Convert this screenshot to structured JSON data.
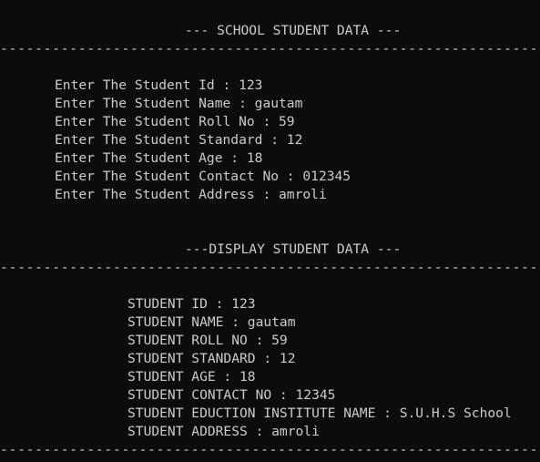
{
  "console": {
    "header_title": "--- SCHOOL STUDENT DATA ---",
    "separator": "------------------------------------------------------------------------------------------------",
    "input_lines": [
      "Enter The Student Id : 123",
      "Enter The Student Name : gautam",
      "Enter The Student Roll No : 59",
      "Enter The Student Standard : 12",
      "Enter The Student Age : 18",
      "Enter The Student Contact No : 012345",
      "Enter The Student Address : amroli"
    ],
    "display_title": "---DISPLAY STUDENT DATA ---",
    "display_lines": [
      "STUDENT ID : 123",
      "STUDENT NAME : gautam",
      "STUDENT ROLL NO : 59",
      "STUDENT STANDARD : 12",
      "STUDENT AGE : 18",
      "STUDENT CONTACT NO : 12345",
      "STUDENT EDUCTION INSTITUTE NAME : S.U.H.S School",
      "STUDENT ADDRESS : amroli"
    ],
    "colors": {
      "background": "#0c0c0c",
      "text": "#cccccc"
    }
  }
}
